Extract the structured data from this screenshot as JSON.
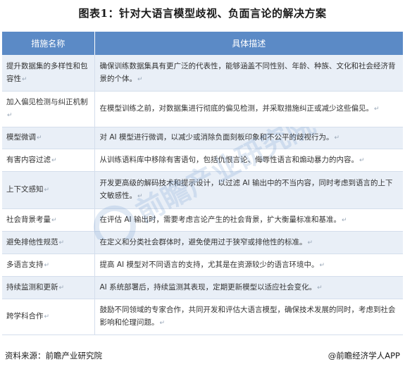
{
  "title": "图表1：针对大语言模型歧视、负面言论的解决方案",
  "table": {
    "headers": [
      "措施名称",
      "具体描述"
    ],
    "rows": [
      {
        "name": "提升数据集的多样性和包容性",
        "desc": "确保训练数据集具有更广泛的代表性，能够涵盖不同性别、年龄、种族、文化和社会经济背景的个体。"
      },
      {
        "name": "加入偏见检测与纠正机制",
        "desc": "在模型训练之前，对数据集进行彻底的偏见检测，并采取措施纠正或减少这些偏见。"
      },
      {
        "name": "模型微调",
        "desc": "对 AI 模型进行微调，以减少或消除负面刻板印象和不公平的歧视行为。"
      },
      {
        "name": "有害内容过滤",
        "desc": "从训练语料库中移除有害语句，包括仇恨言论、侮辱性语言和煽动暴力的内容。"
      },
      {
        "name": "上下文感知",
        "desc": "开发更高级的解码技术和提示设计，以过滤 AI 输出中的不当内容，同时考虑到语言的上下文敏感性。"
      },
      {
        "name": "社会背景考量",
        "desc": "在评估 AI 输出时，需要考虑言论产生的社会背景，扩大衡量标准和基准。"
      },
      {
        "name": "避免排他性规范",
        "desc": "在定义和分类社会群体时，避免使用过于狭窄或排他性的标准。"
      },
      {
        "name": "多语言支持",
        "desc": "提高 AI 模型对不同语言的支持，尤其是在资源较少的语言环境中。"
      },
      {
        "name": "持续监测和更新",
        "desc": "AI 系统部署后，持续监测其表现，定期更新模型以适应社会变化。"
      },
      {
        "name": "跨学科合作",
        "desc": "鼓励不同领域的专家合作，共同开发和评估大语言模型，确保技术发展的同时，考虑到社会影响和伦理问题。"
      }
    ]
  },
  "paragraph_mark": "↵",
  "watermark": "前瞻产业研究院",
  "footer": {
    "source": "资料来源：前瞻产业研究院",
    "brand": "@前瞻经济学人APP"
  }
}
